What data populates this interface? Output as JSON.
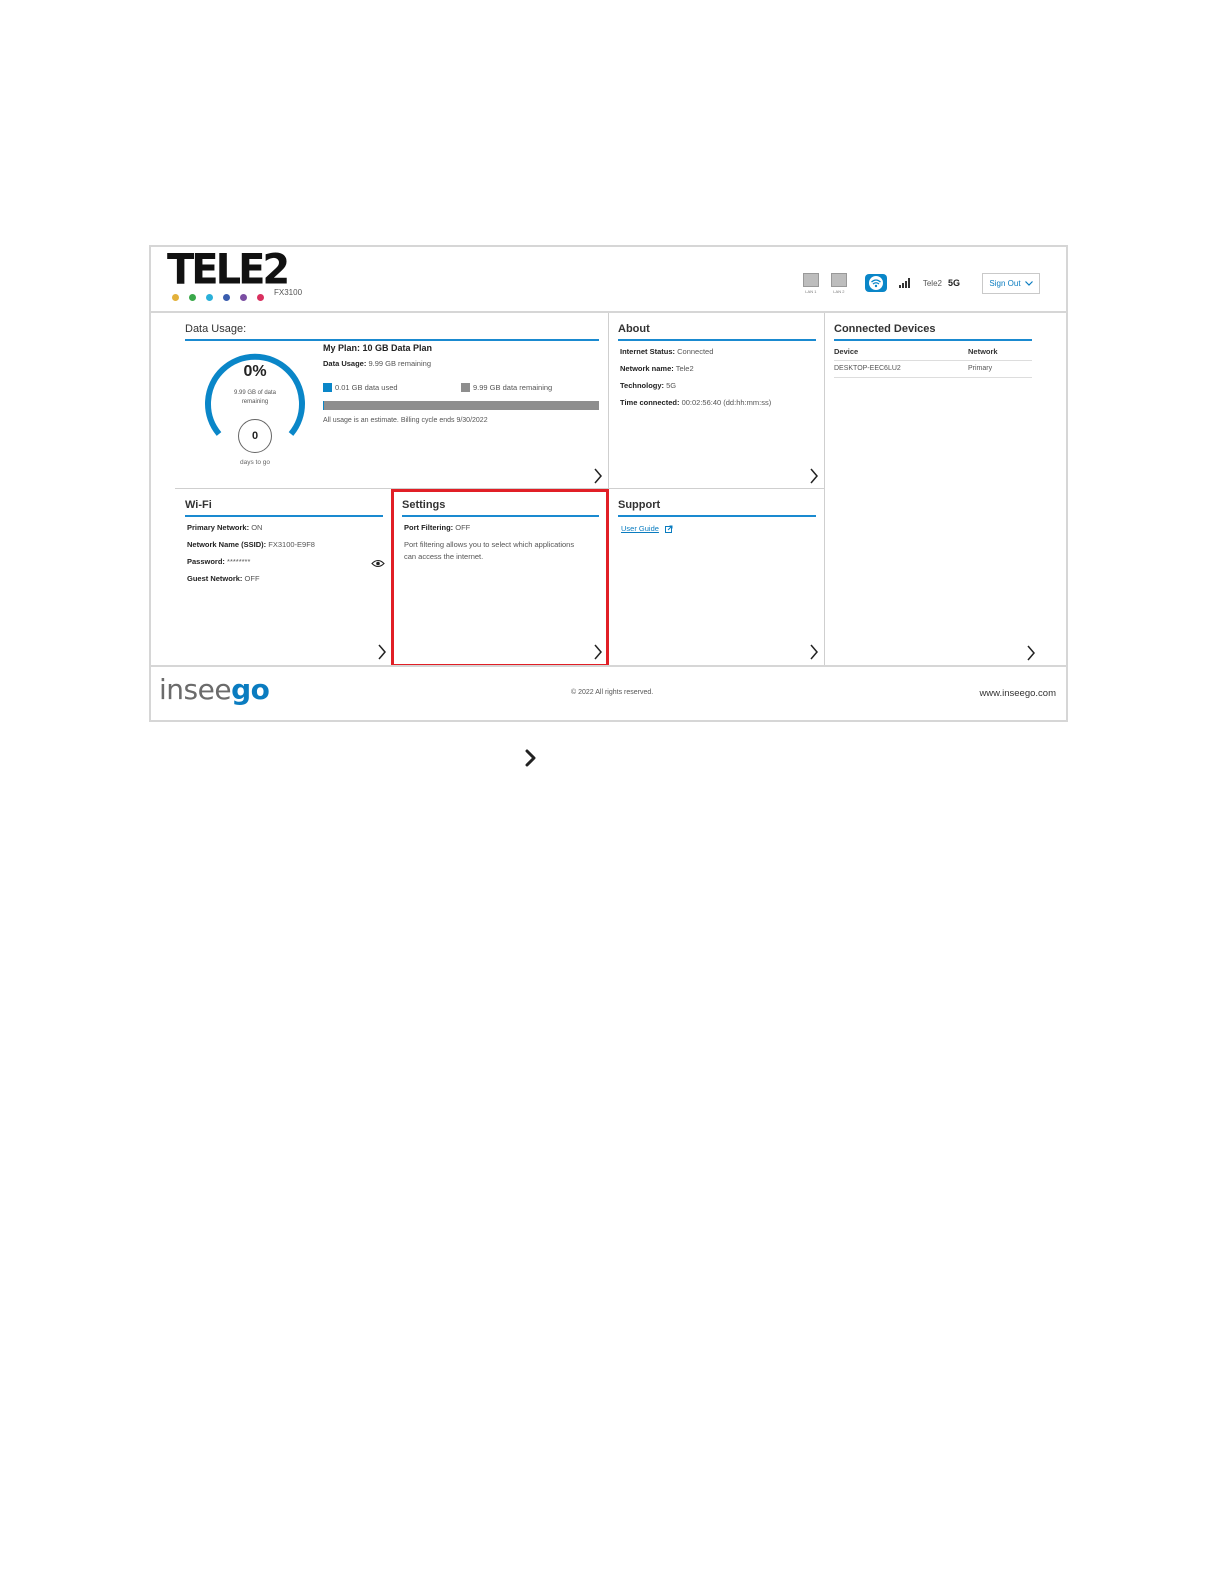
{
  "header": {
    "logo": "TELE2",
    "model": "FX3100",
    "brand_dot_colors": [
      "#e3b13b",
      "#3aa84a",
      "#2ab0d9",
      "#3a5dae",
      "#7b4ea3",
      "#d9305f"
    ],
    "lan1_label": "LAN 1",
    "lan2_label": "LAN 2",
    "carrier": "Tele2",
    "technology": "5G",
    "signout_label": "Sign Out"
  },
  "data_usage": {
    "title": "Data Usage:",
    "percent": "0%",
    "gauge_sub": "9.99 GB of data remaining",
    "days": "0",
    "days_label": "days to go",
    "plan": "My Plan: 10 GB Data Plan",
    "usage_label": "Data Usage:",
    "usage_value": "9.99 GB remaining",
    "used_legend": "0.01 GB data used",
    "remaining_legend": "9.99 GB data remaining",
    "used_fraction": 0.001,
    "estimate": "All usage is an estimate. Billing cycle ends 9/30/2022"
  },
  "about": {
    "title": "About",
    "status_label": "Internet Status:",
    "status_value": "Connected",
    "network_label": "Network name:",
    "network_value": "Tele2",
    "tech_label": "Technology:",
    "tech_value": "5G",
    "time_label": "Time connected:",
    "time_value": "00:02:56:40 (dd:hh:mm:ss)"
  },
  "connected_devices": {
    "title": "Connected Devices",
    "col_device": "Device",
    "col_network": "Network",
    "rows": [
      {
        "device": "DESKTOP-EEC6LU2",
        "network": "Primary"
      }
    ]
  },
  "wifi": {
    "title": "Wi-Fi",
    "primary_label": "Primary Network:",
    "primary_value": "ON",
    "ssid_label": "Network Name (SSID):",
    "ssid_value": "FX3100-E9F8",
    "password_label": "Password:",
    "password_value": "********",
    "guest_label": "Guest Network:",
    "guest_value": "OFF"
  },
  "settings": {
    "title": "Settings",
    "port_label": "Port Filtering:",
    "port_value": "OFF",
    "desc_line1": "Port filtering allows you to select which applications",
    "desc_line2": "can access the internet."
  },
  "support": {
    "title": "Support",
    "user_guide": "User Guide"
  },
  "footer": {
    "brand_a": "insee",
    "brand_b": "go",
    "copyright": "© 2022 All rights reserved.",
    "website": "www.inseego.com"
  },
  "colors": {
    "accent": "#1a8ad0",
    "highlight": "#e11f26"
  }
}
